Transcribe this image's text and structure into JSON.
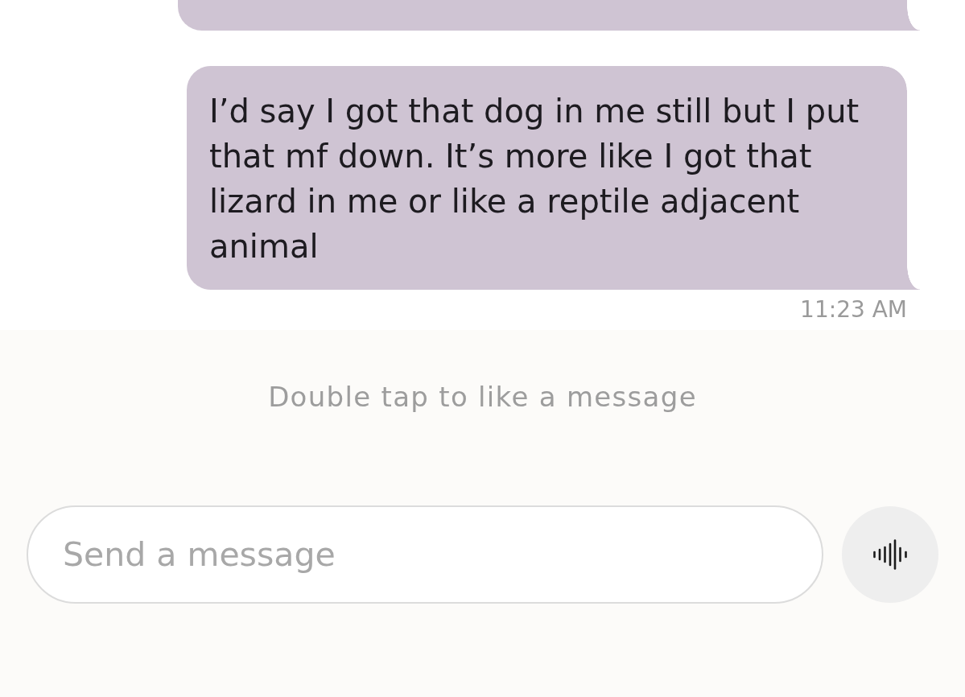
{
  "messages": [
    {
      "kind": "clipped"
    },
    {
      "kind": "full",
      "text": "I’d say I got that dog in me still but I put that mf down. It’s more like I got that lizard in me or like a reptile adjacent animal",
      "time": "11:23 AM"
    }
  ],
  "hint": "Double tap to like a message",
  "composer": {
    "placeholder": "Send a message"
  }
}
